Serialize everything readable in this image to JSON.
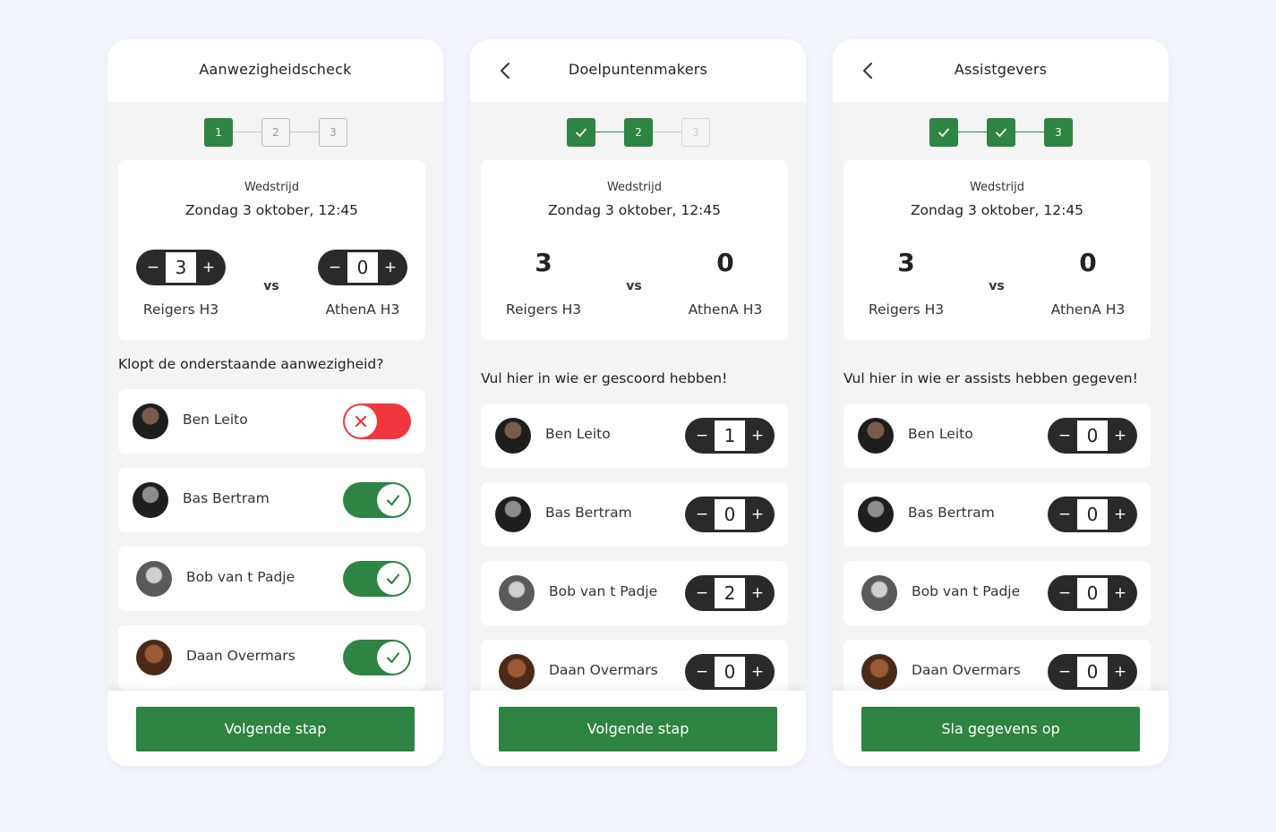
{
  "colors": {
    "accent": "#2e8442",
    "danger": "#f0373e",
    "counter": "#2a2a2a",
    "background": "#f2f5fb"
  },
  "match": {
    "label": "Wedstrijd",
    "date": "Zondag 3 oktober, 12:45",
    "home_team": "Reigers H3",
    "away_team": "AthenA H3",
    "vs": "vs",
    "home_score": "3",
    "away_score": "0"
  },
  "counter_icons": {
    "minus": "−",
    "plus": "+"
  },
  "screens": [
    {
      "title": "Aanwezigheidscheck",
      "steps": [
        {
          "label": "1",
          "state": "active"
        },
        {
          "label": "2",
          "state": "pending"
        },
        {
          "label": "3",
          "state": "pending"
        }
      ],
      "question": "Klopt de onderstaande aanwezigheid?",
      "players": [
        {
          "name": "Ben Leito",
          "present": false
        },
        {
          "name": "Bas Bertram",
          "present": true
        },
        {
          "name": "Bob van t Padje",
          "present": true
        },
        {
          "name": "Daan Overmars",
          "present": true
        }
      ],
      "button": "Volgende stap"
    },
    {
      "title": "Doelpuntenmakers",
      "back_icon": "chevron-left-icon",
      "steps": [
        {
          "label": "check",
          "state": "done"
        },
        {
          "label": "2",
          "state": "active"
        },
        {
          "label": "3",
          "state": "pending"
        }
      ],
      "question": "Vul hier in wie er gescoord hebben!",
      "players": [
        {
          "name": "Ben Leito",
          "count": "1"
        },
        {
          "name": "Bas Bertram",
          "count": "0"
        },
        {
          "name": "Bob van t Padje",
          "count": "2"
        },
        {
          "name": "Daan Overmars",
          "count": "0"
        }
      ],
      "button": "Volgende stap"
    },
    {
      "title": "Assistgevers",
      "back_icon": "chevron-left-icon",
      "steps": [
        {
          "label": "check",
          "state": "done"
        },
        {
          "label": "check",
          "state": "done"
        },
        {
          "label": "3",
          "state": "active"
        }
      ],
      "question": "Vul hier in wie er assists hebben gegeven!",
      "players": [
        {
          "name": "Ben Leito",
          "count": "0"
        },
        {
          "name": "Bas Bertram",
          "count": "0"
        },
        {
          "name": "Bob van t Padje",
          "count": "0"
        },
        {
          "name": "Daan Overmars",
          "count": "0"
        }
      ],
      "button": "Sla gegevens op"
    }
  ]
}
